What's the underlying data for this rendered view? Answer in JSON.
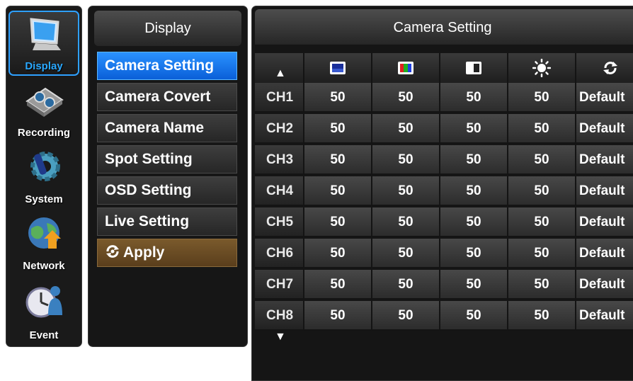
{
  "sidebar": {
    "items": [
      {
        "label": "Display",
        "icon": "monitor-icon",
        "active": true
      },
      {
        "label": "Recording",
        "icon": "film-reel-icon"
      },
      {
        "label": "System",
        "icon": "gear-icon"
      },
      {
        "label": "Network",
        "icon": "globe-icon"
      },
      {
        "label": "Event",
        "icon": "clock-person-icon"
      }
    ]
  },
  "menu": {
    "title": "Display",
    "items": [
      {
        "label": "Camera Setting",
        "active": true
      },
      {
        "label": "Camera Covert"
      },
      {
        "label": "Camera Name"
      },
      {
        "label": "Spot Setting"
      },
      {
        "label": "OSD Setting"
      },
      {
        "label": "Live Setting"
      }
    ],
    "apply_label": "Apply"
  },
  "panel": {
    "title": "Camera Setting",
    "columns": [
      "brightness-icon",
      "color-icon",
      "contrast-icon",
      "sharpness-icon",
      "reset-icon"
    ],
    "rows": [
      {
        "ch": "CH1",
        "values": [
          "50",
          "50",
          "50",
          "50",
          "Default"
        ]
      },
      {
        "ch": "CH2",
        "values": [
          "50",
          "50",
          "50",
          "50",
          "Default"
        ]
      },
      {
        "ch": "CH3",
        "values": [
          "50",
          "50",
          "50",
          "50",
          "Default"
        ]
      },
      {
        "ch": "CH4",
        "values": [
          "50",
          "50",
          "50",
          "50",
          "Default"
        ]
      },
      {
        "ch": "CH5",
        "values": [
          "50",
          "50",
          "50",
          "50",
          "Default"
        ]
      },
      {
        "ch": "CH6",
        "values": [
          "50",
          "50",
          "50",
          "50",
          "Default"
        ]
      },
      {
        "ch": "CH7",
        "values": [
          "50",
          "50",
          "50",
          "50",
          "Default"
        ]
      },
      {
        "ch": "CH8",
        "values": [
          "50",
          "50",
          "50",
          "50",
          "Default"
        ]
      }
    ],
    "scroll_up": "▲",
    "scroll_down": "▼"
  },
  "colors": {
    "accent_blue": "#2a92ff",
    "apply_brown": "#7a5a2c",
    "background": "#151515"
  }
}
